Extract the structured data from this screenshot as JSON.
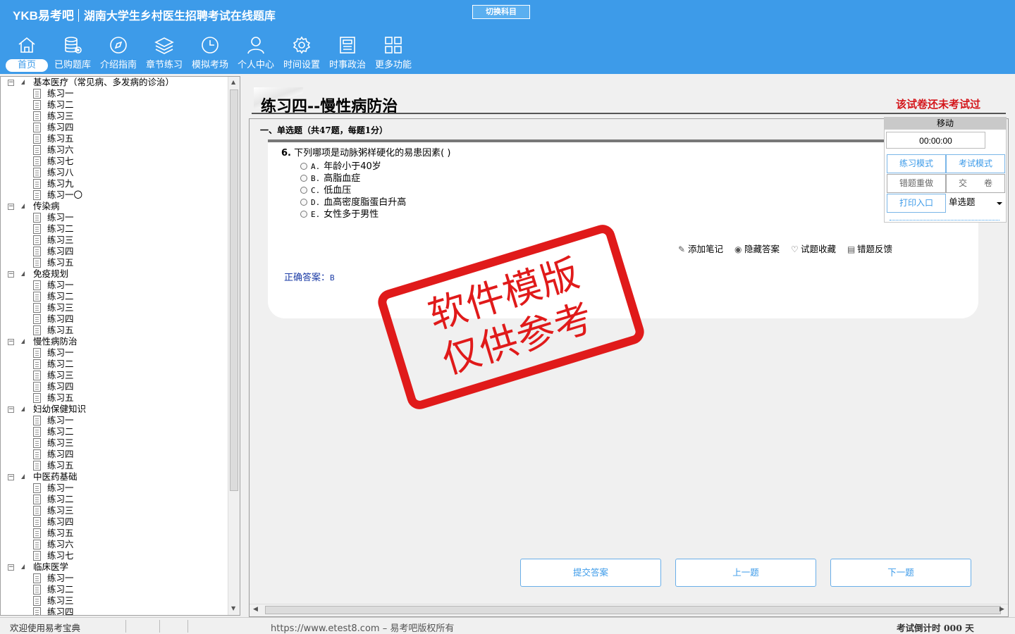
{
  "header": {
    "logo": "YKB易考吧",
    "title": "湖南大学生乡村医生招聘考试在线题库",
    "switch_button": "切换科目"
  },
  "nav": [
    {
      "label": "首页",
      "icon": "home-icon"
    },
    {
      "label": "已购题库",
      "icon": "database-icon"
    },
    {
      "label": "介绍指南",
      "icon": "compass-icon"
    },
    {
      "label": "章节练习",
      "icon": "layers-icon"
    },
    {
      "label": "模拟考场",
      "icon": "clock-icon"
    },
    {
      "label": "个人中心",
      "icon": "user-icon"
    },
    {
      "label": "时间设置",
      "icon": "gear-icon"
    },
    {
      "label": "时事政治",
      "icon": "newspaper-icon"
    },
    {
      "label": "更多功能",
      "icon": "grid-icon"
    }
  ],
  "tree": [
    {
      "label": "基本医疗（常见病、多发病的诊治）",
      "items": [
        "练习一",
        "练习二",
        "练习三",
        "练习四",
        "练习五",
        "练习六",
        "练习七",
        "练习八",
        "练习九",
        "练习一〇"
      ]
    },
    {
      "label": "传染病",
      "items": [
        "练习一",
        "练习二",
        "练习三",
        "练习四",
        "练习五"
      ]
    },
    {
      "label": "免疫规划",
      "items": [
        "练习一",
        "练习二",
        "练习三",
        "练习四",
        "练习五"
      ]
    },
    {
      "label": "慢性病防治",
      "items": [
        "练习一",
        "练习二",
        "练习三",
        "练习四",
        "练习五"
      ]
    },
    {
      "label": "妇幼保健知识",
      "items": [
        "练习一",
        "练习二",
        "练习三",
        "练习四",
        "练习五"
      ]
    },
    {
      "label": "中医药基础",
      "items": [
        "练习一",
        "练习二",
        "练习三",
        "练习四",
        "练习五",
        "练习六",
        "练习七"
      ]
    },
    {
      "label": "临床医学",
      "items": [
        "练习一",
        "练习二",
        "练习三",
        "练习四"
      ]
    }
  ],
  "paper": {
    "title": "练习四--慢性病防治",
    "status": "该试卷还未考试过",
    "section": "一、单选题（共47题，每题1分）"
  },
  "question": {
    "number": "6.",
    "stem": "下列哪项是动脉粥样硬化的易患因素( )",
    "options": [
      {
        "key": "A.",
        "text": "年龄小于40岁"
      },
      {
        "key": "B.",
        "text": "高脂血症"
      },
      {
        "key": "C.",
        "text": "低血压"
      },
      {
        "key": "D.",
        "text": "血高密度脂蛋白升高"
      },
      {
        "key": "E.",
        "text": "女性多于男性"
      }
    ],
    "answer_label": "正确答案：",
    "answer_value": "B"
  },
  "tools": {
    "add_note": "添加笔记",
    "hide_answer": "隐藏答案",
    "favorite": "试题收藏",
    "feedback": "错题反馈"
  },
  "control": {
    "move": "移动",
    "timer": "00:00:00",
    "practice_mode": "练习模式",
    "exam_mode": "考试模式",
    "redo_wrong": "错题重做",
    "submit_paper": "交　　卷",
    "print": "打印入口",
    "type_select": "单选题"
  },
  "buttons": {
    "submit": "提交答案",
    "prev": "上一题",
    "next": "下一题"
  },
  "watermark": {
    "line1": "软件模版",
    "line2": "仅供参考"
  },
  "statusbar": {
    "welcome": "欢迎使用易考宝典",
    "copyright": "https://www.etest8.com – 易考吧版权所有",
    "countdown": "考试倒计时 000 天"
  },
  "colors": {
    "header_bg": "#3d9be9",
    "status_red": "#d4151a",
    "answer_blue": "#1a3aa5",
    "stamp_red": "#e01a1a"
  }
}
